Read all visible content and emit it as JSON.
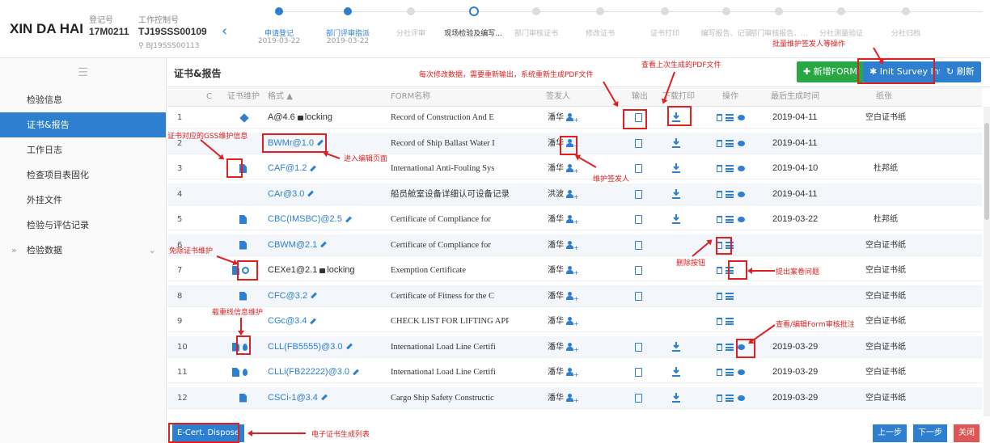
{
  "header": {
    "brand": "XIN DA HAI",
    "reg_label": "登记号",
    "reg_no": "17M0211",
    "ctrl_label": "工作控制号",
    "ctrl_no": "TJ19SSS00109",
    "sub_no": "BJ19SSS00113"
  },
  "steps": [
    {
      "label": "申请登记",
      "date": "2019-03-22",
      "state": "done"
    },
    {
      "label": "部门评审指派",
      "date": "2019-03-22",
      "state": "done"
    },
    {
      "label": "分社评审",
      "date": "",
      "state": "todo"
    },
    {
      "label": "现场检验及编写...",
      "date": "",
      "state": "current"
    },
    {
      "label": "部门审核证书",
      "date": "",
      "state": "todo"
    },
    {
      "label": "修改证书",
      "date": "",
      "state": "todo"
    },
    {
      "label": "证书打印",
      "date": "",
      "state": "todo"
    },
    {
      "label": "编写报告、记录",
      "date": "",
      "state": "todo"
    },
    {
      "label": "部门审核报告、...",
      "date": "",
      "state": "todo"
    },
    {
      "label": "分社测量验证",
      "date": "",
      "state": "todo"
    },
    {
      "label": "分社归档",
      "date": "",
      "state": "todo"
    }
  ],
  "sidebar": {
    "items": [
      "检验信息",
      "证书&报告",
      "工作日志",
      "检查项目表固化",
      "外挂文件",
      "检验与评估记录",
      "检验数据"
    ]
  },
  "main": {
    "title": "证书&报告",
    "new_form": "新增FORM",
    "init_survey": "Init Survey Info",
    "refresh": "刷新"
  },
  "columns": [
    "C",
    "证书维护",
    "格式",
    "FORM名称",
    "签发人",
    "输出",
    "下载打印",
    "操作",
    "最后生成时间",
    "纸张"
  ],
  "rows": [
    {
      "n": "1",
      "fmt": "A@4.6",
      "locking": "locking",
      "form": "Record of Construction And E",
      "signer": "潘华",
      "date": "2019-04-11",
      "paper": "空白证书纸",
      "m": "tag",
      "dl": true,
      "eye": true,
      "pdf": true,
      "list": true
    },
    {
      "n": "2",
      "fmt": "BWMr@1.0",
      "locking": "",
      "form": "Record of Ship Ballast Water I",
      "signer": "潘华",
      "date": "2019-04-11",
      "paper": "",
      "m": "",
      "dl": true,
      "eye": true,
      "pdf": true,
      "list": true
    },
    {
      "n": "3",
      "fmt": "CAF@1.2",
      "locking": "",
      "form": "International Anti-Fouling Sys",
      "signer": "潘华",
      "date": "2019-04-10",
      "paper": "杜邦纸",
      "m": "doc",
      "dl": true,
      "eye": true,
      "pdf": true,
      "list": true
    },
    {
      "n": "4",
      "fmt": "CAr@3.0",
      "locking": "",
      "form": "船员舱室设备详细认可设备记录",
      "signer": "洪波",
      "date": "2019-04-11",
      "paper": "",
      "m": "",
      "dl": true,
      "eye": true,
      "pdf": true,
      "list": true
    },
    {
      "n": "5",
      "fmt": "CBC(IMSBC)@2.5",
      "locking": "",
      "form": "Certificate of Compliance for",
      "signer": "潘华",
      "date": "2019-03-22",
      "paper": "杜邦纸",
      "m": "doc",
      "dl": true,
      "eye": true,
      "pdf": true,
      "list": true
    },
    {
      "n": "6",
      "fmt": "CBWM@2.1",
      "locking": "",
      "form": "Certificate of Compliance for",
      "signer": "潘华",
      "date": "",
      "paper": "空白证书纸",
      "m": "doc",
      "dl": false,
      "eye": false,
      "pdf": true,
      "list": true
    },
    {
      "n": "7",
      "fmt": "CEXe1@2.1",
      "locking": "locking",
      "form": "Exemption Certificate",
      "signer": "潘华",
      "date": "",
      "paper": "空白证书纸",
      "m": "doccircle",
      "dl": false,
      "eye": false,
      "pdf": true,
      "list": true
    },
    {
      "n": "8",
      "fmt": "CFC@3.2",
      "locking": "",
      "form": "Certificate of Fitness for the C",
      "signer": "潘华",
      "date": "",
      "paper": "空白证书纸",
      "m": "doc",
      "dl": false,
      "eye": false,
      "pdf": true,
      "list": true
    },
    {
      "n": "9",
      "fmt": "CGc@3.4",
      "locking": "",
      "form": "CHECK LIST FOR LIFTING APP",
      "signer": "潘华",
      "date": "",
      "paper": "空白证书纸",
      "m": "",
      "dl": false,
      "eye": false,
      "pdf": false,
      "list": true
    },
    {
      "n": "10",
      "fmt": "CLL(FB5555)@3.0",
      "locking": "",
      "form": "International Load Line Certifi",
      "signer": "潘华",
      "date": "2019-03-29",
      "paper": "空白证书纸",
      "m": "docdrop",
      "dl": true,
      "eye": true,
      "pdf": true,
      "list": true
    },
    {
      "n": "11",
      "fmt": "CLLi(FB22222)@3.0",
      "locking": "",
      "form": "International Load Line Certifi",
      "signer": "潘华",
      "date": "2019-03-29",
      "paper": "空白证书纸",
      "m": "docdrop",
      "dl": true,
      "eye": true,
      "pdf": true,
      "list": true
    },
    {
      "n": "12",
      "fmt": "CSCi-1@3.4",
      "locking": "",
      "form": "Cargo Ship Safety Constructic",
      "signer": "潘华",
      "date": "2019-03-29",
      "paper": "空白证书纸",
      "m": "doc",
      "dl": true,
      "eye": true,
      "pdf": true,
      "list": true
    }
  ],
  "annotations": {
    "regen": "每次修改数据，需要重新输出，系统重新生成PDF文件",
    "view_pdf": "查看上次生成的PDF文件",
    "batch": "批量维护签发人等操作",
    "gss": "证书对应的GSS维护信息",
    "edit": "进入编辑页面",
    "signer": "维护签发人",
    "exempt": "免除证书维护",
    "delete": "删除按钮",
    "submit": "提出案卷问题",
    "loadline": "载重线信息维护",
    "view_form": "查看/编辑Form审核批注",
    "ecert": "电子证书生成列表"
  },
  "footer": {
    "ecert": "E-Cert. Dispose",
    "prev": "上一步",
    "next": "下一步",
    "close": "关闭"
  },
  "colors": {
    "accent": "#2f7fd1",
    "green": "#28a745",
    "red": "#e02020"
  }
}
